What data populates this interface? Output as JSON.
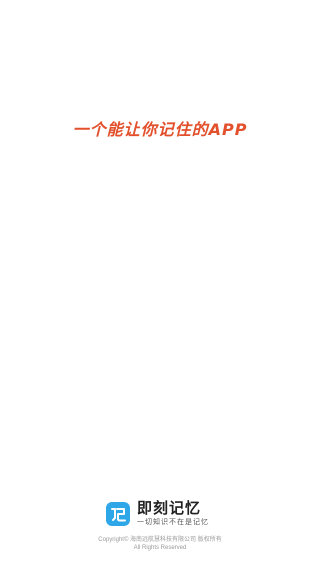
{
  "splash": {
    "slogan": "一个能让你记住的APP",
    "slogan_color": "#e2502c"
  },
  "brand": {
    "logo_icon": "ji-logo-icon",
    "logo_glyph": "记",
    "logo_color": "#2ea7e8",
    "name": "即刻记忆",
    "name_color": "#222222",
    "tagline": "一切知识不在是记忆"
  },
  "footer": {
    "copyright_line1": "Copyright© 海南远航慧科技有限公司 版权所有",
    "copyright_line2": "All Rights Reserved"
  }
}
